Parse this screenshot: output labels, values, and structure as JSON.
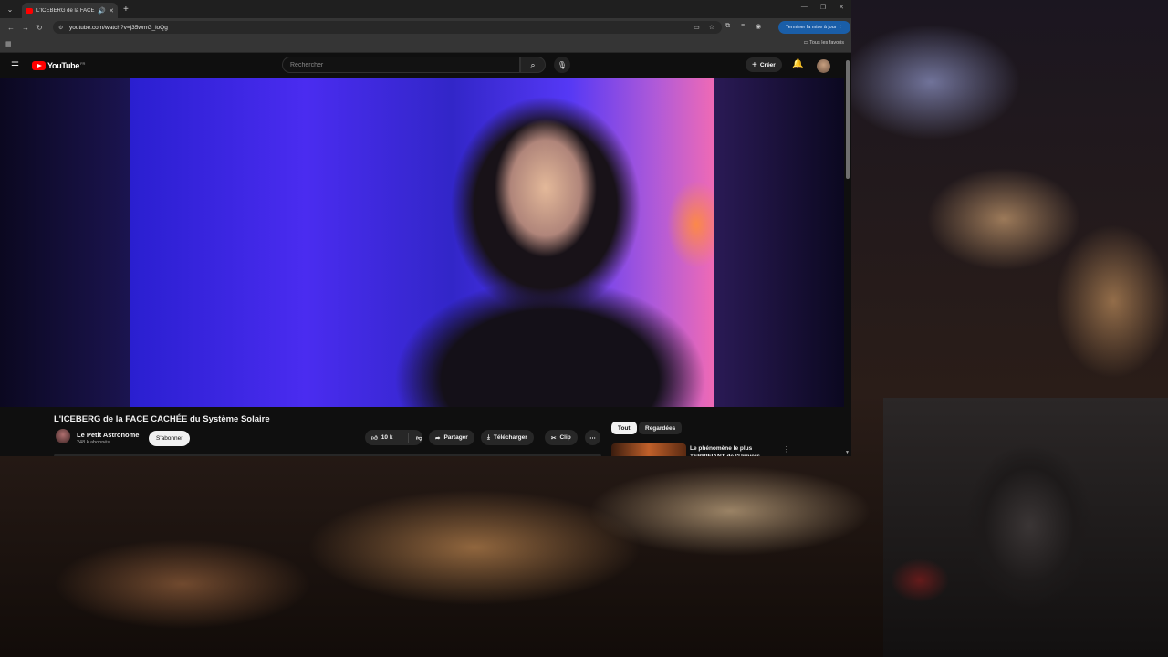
{
  "browser": {
    "tab_title": "L'ICEBERG de la FACE CACHÉE du Système Solaire",
    "url": "youtube.com/watch?v=j35wmG_ioQg",
    "update_button": "Terminer la mise à jour",
    "bookmarks_all": "Tous les favoris"
  },
  "youtube": {
    "logo_text": "YouTube",
    "logo_country": "FR",
    "search_placeholder": "Rechercher",
    "create_label": "Créer"
  },
  "video": {
    "title": "L'ICEBERG de la FACE CACHÉE du Système Solaire",
    "channel_name": "Le Petit Astronome",
    "subscribers": "248 k abonnés",
    "subscribe_label": "S'abonner",
    "likes": "10 k",
    "share_label": "Partager",
    "download_label": "Télécharger",
    "clip_label": "Clip"
  },
  "sidebar": {
    "chips": [
      "Tout",
      "Regardées"
    ],
    "recommended_title": "Le phénomène le plus TERRIFIANT de l'Univers"
  },
  "colors": {
    "youtube_red": "#ff0000",
    "update_button_bg": "#1a5ea8",
    "page_bg": "#0f0f0f"
  }
}
